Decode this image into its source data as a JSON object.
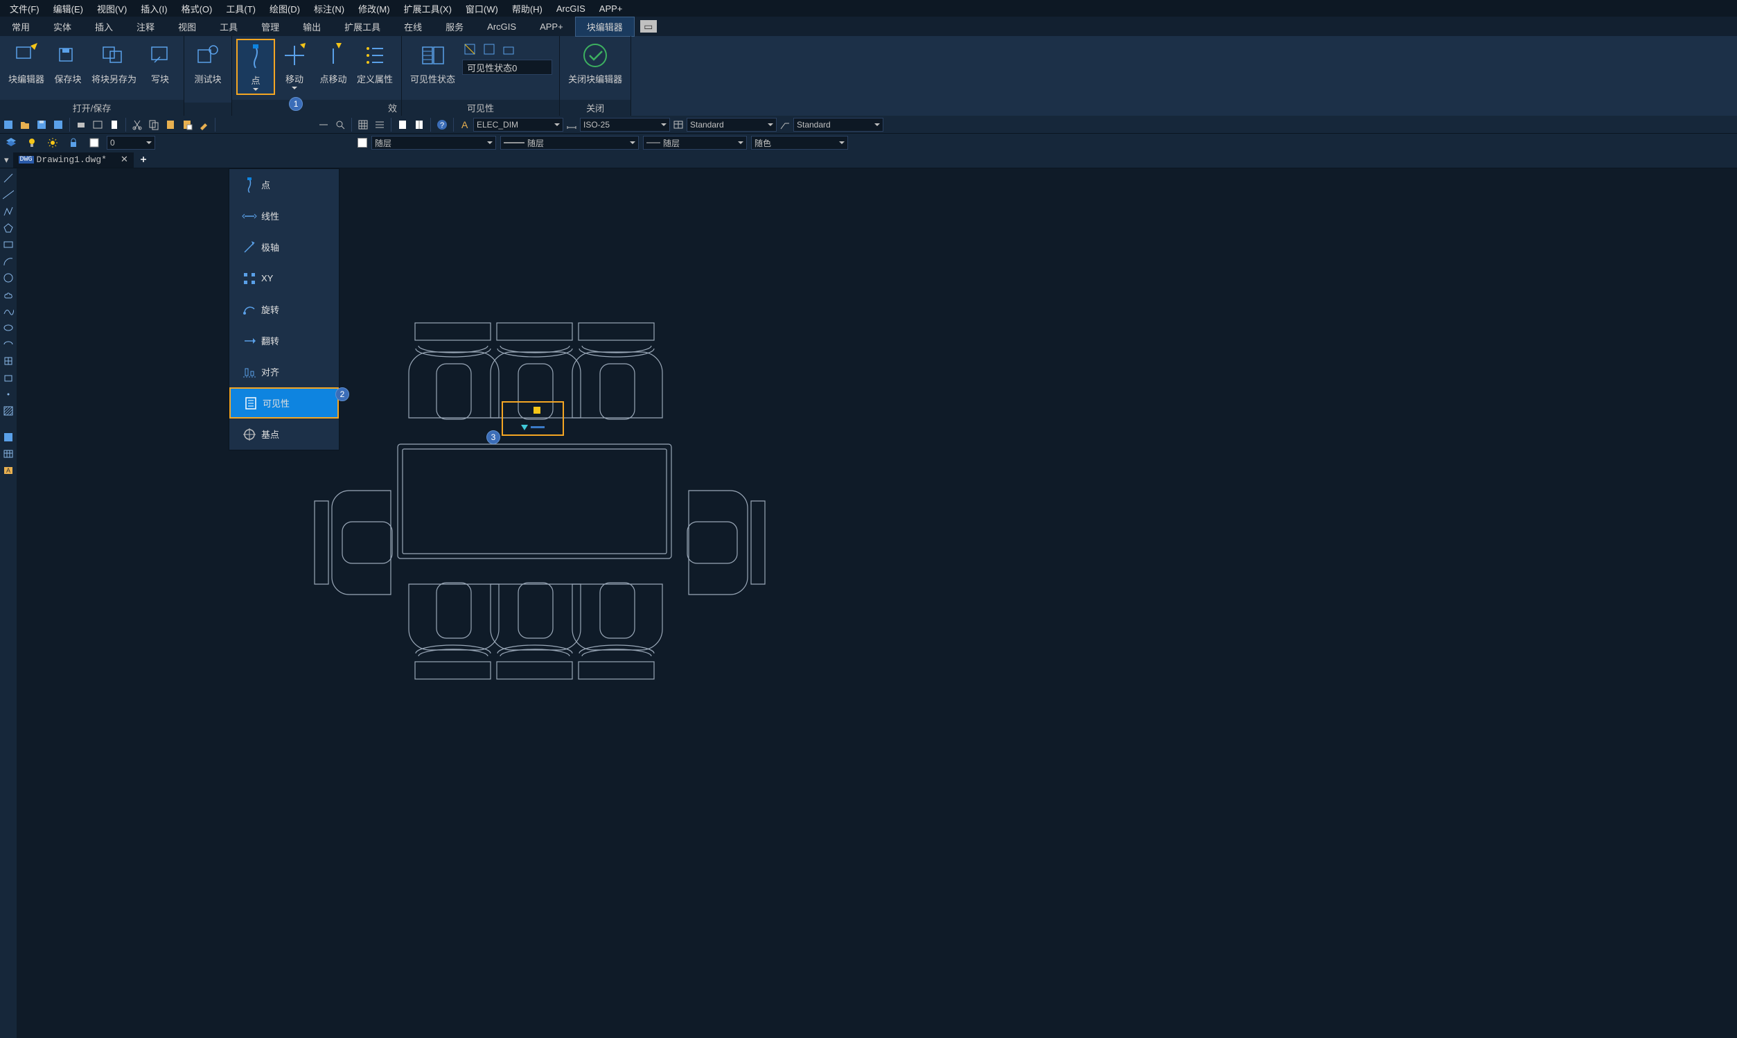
{
  "menubar": [
    "文件(F)",
    "编辑(E)",
    "视图(V)",
    "插入(I)",
    "格式(O)",
    "工具(T)",
    "绘图(D)",
    "标注(N)",
    "修改(M)",
    "扩展工具(X)",
    "窗口(W)",
    "帮助(H)",
    "ArcGIS",
    "APP+"
  ],
  "ribbon_tabs": [
    "常用",
    "实体",
    "插入",
    "注释",
    "视图",
    "工具",
    "管理",
    "输出",
    "扩展工具",
    "在线",
    "服务",
    "ArcGIS",
    "APP+",
    "块编辑器"
  ],
  "active_tab_index": 13,
  "ribbon": {
    "panel1": {
      "label": "打开/保存",
      "btns": [
        "块编辑器",
        "保存块",
        "将块另存为",
        "写块"
      ]
    },
    "panel2": {
      "btns": [
        "测试块"
      ]
    },
    "panel3": {
      "btns": [
        "点",
        "移动",
        "点移动",
        "定义属性"
      ]
    },
    "panel4": {
      "label": "可见性",
      "btns": [
        "可见性状态"
      ],
      "dd_value": "可见性状态0"
    },
    "panel5": {
      "label": "关闭",
      "btns": [
        "关闭块编辑器"
      ]
    },
    "panel3_label_partial": "效"
  },
  "prop_dropdowns": {
    "layer": "ELEC_DIM",
    "dim": "ISO-25",
    "text": "Standard",
    "table": "Standard",
    "r2_a": "随层",
    "r2_b": "随层",
    "r2_c": "随层",
    "r2_d": "随色",
    "layer_num": "0"
  },
  "doc_tab": {
    "name": "Drawing1.dwg*",
    "badge": "DWG"
  },
  "dropdown_menu": {
    "items": [
      {
        "text": "点"
      },
      {
        "text": "线性"
      },
      {
        "text": "极轴"
      },
      {
        "text": "XY"
      },
      {
        "text": "旋转"
      },
      {
        "text": "翻转"
      },
      {
        "text": "对齐"
      },
      {
        "text": "可见性"
      },
      {
        "text": "基点"
      }
    ],
    "selected_index": 7
  },
  "callouts": {
    "c1": "1",
    "c2": "2",
    "c3": "3"
  }
}
